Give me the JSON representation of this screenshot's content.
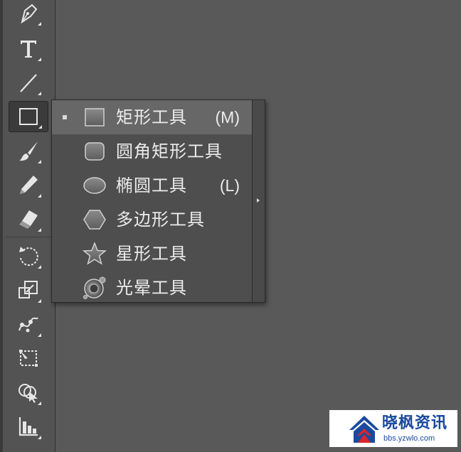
{
  "toolbar": {
    "tools": [
      {
        "name": "pen-tool",
        "icon": "pen-icon",
        "has_flyout": true
      },
      {
        "name": "type-tool",
        "icon": "type-icon",
        "has_flyout": true
      },
      {
        "name": "line-segment-tool",
        "icon": "line-icon",
        "has_flyout": true
      },
      {
        "name": "rectangle-tool",
        "icon": "rectangle-icon",
        "has_flyout": true,
        "active": true
      },
      {
        "name": "paintbrush-tool",
        "icon": "brush-icon",
        "has_flyout": true
      },
      {
        "name": "pencil-tool",
        "icon": "pencil-icon",
        "has_flyout": true
      },
      {
        "name": "eraser-tool",
        "icon": "eraser-icon",
        "has_flyout": true
      },
      {
        "name": "rotate-tool",
        "icon": "rotate-icon",
        "has_flyout": true
      },
      {
        "name": "scale-tool",
        "icon": "scale-icon",
        "has_flyout": true
      },
      {
        "name": "puppet-warp-tool",
        "icon": "warp-icon",
        "has_flyout": true
      },
      {
        "name": "free-transform-tool",
        "icon": "free-transform-icon",
        "has_flyout": false
      },
      {
        "name": "shape-builder-tool",
        "icon": "shape-builder-icon",
        "has_flyout": true
      },
      {
        "name": "graph-tool",
        "icon": "graph-icon",
        "has_flyout": true
      }
    ]
  },
  "flyout": {
    "items": [
      {
        "label": "矩形工具",
        "shortcut": "(M)",
        "icon": "rectangle-icon",
        "selected": true
      },
      {
        "label": "圆角矩形工具",
        "shortcut": "",
        "icon": "rounded-rectangle-icon",
        "selected": false
      },
      {
        "label": "椭圆工具",
        "shortcut": "(L)",
        "icon": "ellipse-icon",
        "selected": false
      },
      {
        "label": "多边形工具",
        "shortcut": "",
        "icon": "polygon-icon",
        "selected": false
      },
      {
        "label": "星形工具",
        "shortcut": "",
        "icon": "star-icon",
        "selected": false
      },
      {
        "label": "光晕工具",
        "shortcut": "",
        "icon": "flare-icon",
        "selected": false
      }
    ]
  },
  "watermark": {
    "title": "晓枫资讯",
    "url": "bbs.yzwlo.com"
  },
  "colors": {
    "canvas": "#595959",
    "toolbar": "#535353",
    "flyout": "#4e4e4e",
    "selected_row": "#676767",
    "text": "#ececec",
    "watermark_blue": "#1a4a9e",
    "watermark_red": "#d9262c"
  }
}
